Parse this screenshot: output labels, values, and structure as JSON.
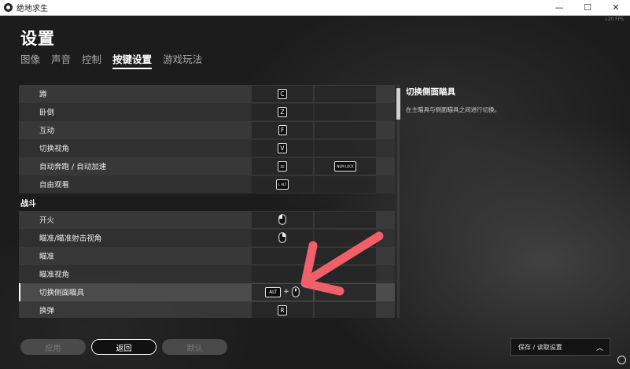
{
  "window": {
    "title": "绝地求生",
    "minimize_glyph": "—",
    "maximize_glyph": "☐",
    "close_glyph": "✕",
    "fps": "120 FPS"
  },
  "header": {
    "title": "设置",
    "tabs": [
      {
        "label": "图像",
        "active": false
      },
      {
        "label": "声音",
        "active": false
      },
      {
        "label": "控制",
        "active": false
      },
      {
        "label": "按键设置",
        "active": true
      },
      {
        "label": "游戏玩法",
        "active": false
      }
    ]
  },
  "bindings": {
    "rows_top": [
      {
        "label": "蹲",
        "key1": "C"
      },
      {
        "label": "卧倒",
        "key1": "Z"
      },
      {
        "label": "互动",
        "key1": "F"
      },
      {
        "label": "切换视角",
        "key1": "V"
      },
      {
        "label": "自动奔跑 / 自动加速",
        "key1": "=",
        "key2": "NUM LOCK"
      },
      {
        "label": "自由观看",
        "key1": "L ALT"
      }
    ],
    "section_combat": "战斗",
    "rows_combat": [
      {
        "label": "开火",
        "key1_icon": "mouse-left-icon"
      },
      {
        "label": "瞄准/瞄准射击视角",
        "key1_icon": "mouse-right-icon"
      },
      {
        "label": "瞄准"
      },
      {
        "label": "瞄准视角"
      },
      {
        "label": "切换侧面瞄具",
        "key1": "ALT",
        "key1_plus": "+",
        "key1_icon": "mouse-wheel-icon",
        "selected": true
      },
      {
        "label": "换弹",
        "key1": "R"
      }
    ]
  },
  "description": {
    "title": "切换侧面瞄具",
    "text": "在主瞄具与侧面瞄具之间进行切换。"
  },
  "footer": {
    "apply_label": "应用",
    "back_label": "返回",
    "default_label": "默认",
    "save_load_label": "保存 / 读取设置",
    "save_load_chevron": "︿"
  },
  "colors": {
    "annotation_arrow": "#f0606a",
    "text_primary": "#ffffff",
    "row_bg": "#3e3e3e"
  }
}
